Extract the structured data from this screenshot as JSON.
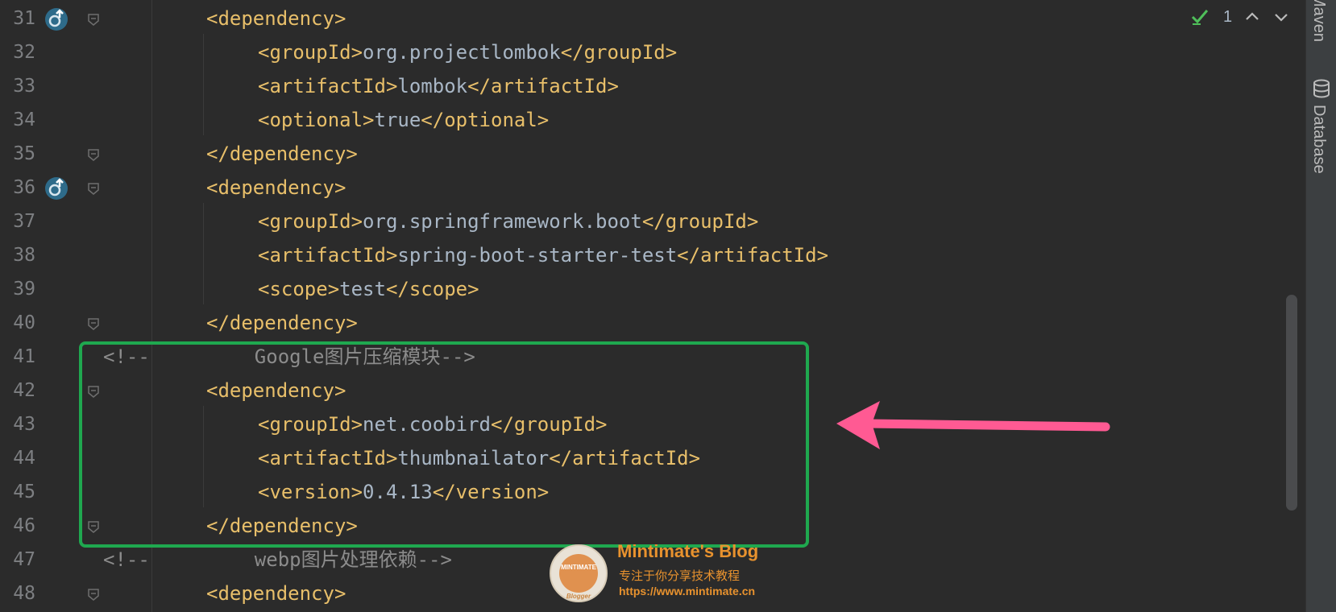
{
  "editor": {
    "lines": [
      {
        "no": "31",
        "parts": [
          {
            "t": "tag",
            "v": "<dependency>"
          }
        ]
      },
      {
        "no": "32",
        "parts": [
          {
            "t": "tag",
            "v": "<groupId>"
          },
          {
            "t": "txt",
            "v": "org.projectlombok"
          },
          {
            "t": "tag",
            "v": "</groupId>"
          }
        ]
      },
      {
        "no": "33",
        "parts": [
          {
            "t": "tag",
            "v": "<artifactId>"
          },
          {
            "t": "txt",
            "v": "lombok"
          },
          {
            "t": "tag",
            "v": "</artifactId>"
          }
        ]
      },
      {
        "no": "34",
        "parts": [
          {
            "t": "tag",
            "v": "<optional>"
          },
          {
            "t": "txt",
            "v": "true"
          },
          {
            "t": "tag",
            "v": "</optional>"
          }
        ]
      },
      {
        "no": "35",
        "parts": [
          {
            "t": "tag",
            "v": "</dependency>"
          }
        ]
      },
      {
        "no": "36",
        "parts": [
          {
            "t": "tag",
            "v": "<dependency>"
          }
        ]
      },
      {
        "no": "37",
        "parts": [
          {
            "t": "tag",
            "v": "<groupId>"
          },
          {
            "t": "txt",
            "v": "org.springframework.boot"
          },
          {
            "t": "tag",
            "v": "</groupId>"
          }
        ]
      },
      {
        "no": "38",
        "parts": [
          {
            "t": "tag",
            "v": "<artifactId>"
          },
          {
            "t": "txt",
            "v": "spring-boot-starter-test"
          },
          {
            "t": "tag",
            "v": "</artifactId>"
          }
        ]
      },
      {
        "no": "39",
        "parts": [
          {
            "t": "tag",
            "v": "<scope>"
          },
          {
            "t": "txt",
            "v": "test"
          },
          {
            "t": "tag",
            "v": "</scope>"
          }
        ]
      },
      {
        "no": "40",
        "parts": [
          {
            "t": "tag",
            "v": "</dependency>"
          }
        ]
      },
      {
        "no": "41",
        "parts": [
          {
            "t": "cmt",
            "v": "<!--"
          },
          {
            "t": "cmt",
            "v": "Google图片压缩模块-->"
          }
        ]
      },
      {
        "no": "42",
        "parts": [
          {
            "t": "tag",
            "v": "<dependency>"
          }
        ]
      },
      {
        "no": "43",
        "parts": [
          {
            "t": "tag",
            "v": "<groupId>"
          },
          {
            "t": "txt",
            "v": "net.coobird"
          },
          {
            "t": "tag",
            "v": "</groupId>"
          }
        ]
      },
      {
        "no": "44",
        "parts": [
          {
            "t": "tag",
            "v": "<artifactId>"
          },
          {
            "t": "txt",
            "v": "thumbnailator"
          },
          {
            "t": "tag",
            "v": "</artifactId>"
          }
        ]
      },
      {
        "no": "45",
        "parts": [
          {
            "t": "tag",
            "v": "<version>"
          },
          {
            "t": "txt",
            "v": "0.4.13"
          },
          {
            "t": "tag",
            "v": "</version>"
          }
        ]
      },
      {
        "no": "46",
        "parts": [
          {
            "t": "tag",
            "v": "</dependency>"
          }
        ]
      },
      {
        "no": "47",
        "parts": [
          {
            "t": "cmt",
            "v": "<!--"
          },
          {
            "t": "cmt",
            "v": "webp图片处理依赖-->"
          }
        ]
      },
      {
        "no": "48",
        "parts": [
          {
            "t": "tag",
            "v": "<dependency>"
          }
        ]
      }
    ]
  },
  "inspections": {
    "count": "1"
  },
  "side_panel": {
    "maven": "Maven",
    "database": "Database"
  },
  "watermark": {
    "logo_text": "MINTIMATE",
    "logo_sub": "Blogger",
    "title": "Mintimate's Blog",
    "subtitle": "专注于你分享技术教程",
    "url": "https://www.mintimate.cn"
  },
  "colors": {
    "tag": "#e8bf6a",
    "text": "#a9b7c6",
    "comment": "#8c8c8c",
    "highlight": "#1fa84f",
    "arrow": "#ff5a93"
  }
}
